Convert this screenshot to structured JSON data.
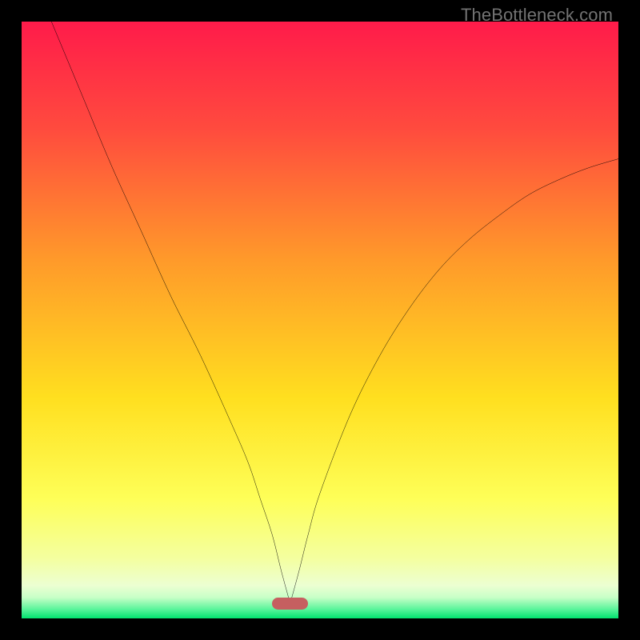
{
  "watermark": "TheBottleneck.com",
  "chart_data": {
    "type": "line",
    "title": "",
    "xlabel": "",
    "ylabel": "",
    "xlim": [
      0,
      100
    ],
    "ylim": [
      0,
      100
    ],
    "gradient_stops": [
      {
        "offset": 0,
        "color": "#ff1b4a"
      },
      {
        "offset": 0.18,
        "color": "#ff4b3e"
      },
      {
        "offset": 0.4,
        "color": "#ff9a2a"
      },
      {
        "offset": 0.63,
        "color": "#ffdf1f"
      },
      {
        "offset": 0.8,
        "color": "#feff58"
      },
      {
        "offset": 0.9,
        "color": "#f4ffa0"
      },
      {
        "offset": 0.945,
        "color": "#ecffd2"
      },
      {
        "offset": 0.965,
        "color": "#c7ffc7"
      },
      {
        "offset": 0.985,
        "color": "#58f49a"
      },
      {
        "offset": 1.0,
        "color": "#01e36f"
      }
    ],
    "series": [
      {
        "name": "bottleneck-curve",
        "x": [
          5,
          10,
          15,
          20,
          25,
          30,
          35,
          38,
          40,
          42,
          43.5,
          45,
          46.5,
          48,
          50,
          55,
          60,
          65,
          70,
          75,
          80,
          85,
          90,
          95,
          100
        ],
        "y": [
          100,
          88,
          76,
          65,
          54,
          44,
          33,
          26,
          20,
          14,
          8,
          2.5,
          8,
          14,
          21,
          34,
          44,
          52,
          58.5,
          63.5,
          67.5,
          71,
          73.5,
          75.5,
          77
        ]
      }
    ],
    "marker": {
      "x_center": 45,
      "y": 2.5,
      "width_pct": 6,
      "height_pct": 2
    },
    "marker_color": "#c65f60"
  }
}
